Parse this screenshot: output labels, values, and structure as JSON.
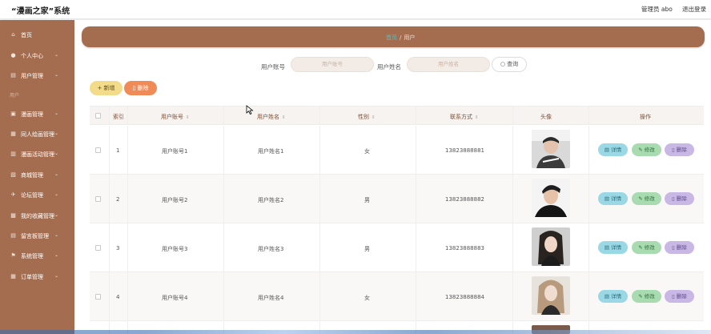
{
  "app": {
    "title": "“漫画之家”系统",
    "user": "管理员 abo",
    "logout": "退出登录"
  },
  "sidebar": {
    "items": [
      {
        "label": "首页",
        "icon": "home-icon",
        "glyph": "⌂",
        "caret": ""
      },
      {
        "label": "个人中心",
        "icon": "user-icon",
        "glyph": "●",
        "caret": "⌄"
      },
      {
        "label": "用户管理",
        "icon": "users-icon",
        "glyph": "▤",
        "caret": "⌄"
      },
      {
        "label": "漫画管理",
        "icon": "book-icon",
        "glyph": "▣",
        "caret": "⌄"
      },
      {
        "label": "同人绘画管理",
        "icon": "paint-icon",
        "glyph": "▦",
        "caret": "⌄"
      },
      {
        "label": "漫画活动管理",
        "icon": "activity-icon",
        "glyph": "▥",
        "caret": "⌄"
      },
      {
        "label": "商城管理",
        "icon": "shop-icon",
        "glyph": "▧",
        "caret": "⌄"
      },
      {
        "label": "论坛管理",
        "icon": "forum-icon",
        "glyph": "✈",
        "caret": "⌄"
      },
      {
        "label": "我的收藏管理",
        "icon": "star-icon",
        "glyph": "▩",
        "caret": "⌄"
      },
      {
        "label": "留言板管理",
        "icon": "message-icon",
        "glyph": "▤",
        "caret": "⌄"
      },
      {
        "label": "系统管理",
        "icon": "flag-icon",
        "glyph": "⚑",
        "caret": "⌄"
      },
      {
        "label": "订单管理",
        "icon": "order-icon",
        "glyph": "▦",
        "caret": "⌄"
      }
    ],
    "extra": "用户"
  },
  "breadcrumb": {
    "home": "首页",
    "sep": "/",
    "current": "用户"
  },
  "filters": {
    "account_label": "用户账号",
    "account_placeholder": "用户账号",
    "name_label": "用户姓名",
    "name_placeholder": "用户姓名",
    "search": "查询"
  },
  "actions": {
    "add": "+ 新增",
    "delete": "删除"
  },
  "table": {
    "headers": {
      "index": "索引",
      "account": "用户账号",
      "name": "用户姓名",
      "gender": "性别",
      "phone": "联系方式",
      "avatar": "头像",
      "ops": "操作"
    },
    "sort_glyph": "⇕",
    "rows": [
      {
        "index": "1",
        "account": "用户账号1",
        "name": "用户姓名1",
        "gender": "女",
        "phone": "13823888881"
      },
      {
        "index": "2",
        "account": "用户账号2",
        "name": "用户姓名2",
        "gender": "男",
        "phone": "13823888882"
      },
      {
        "index": "3",
        "account": "用户账号3",
        "name": "用户姓名3",
        "gender": "男",
        "phone": "13823888883"
      },
      {
        "index": "4",
        "account": "用户账号4",
        "name": "用户姓名4",
        "gender": "女",
        "phone": "13823888884"
      }
    ],
    "row_actions": {
      "view": "详情",
      "edit": "修改",
      "delete": "删除"
    }
  },
  "colors": {
    "brand": "#a56d4f",
    "view": "#9ad8e6",
    "edit": "#a8dcb0",
    "delete": "#c9b7e6",
    "add": "#f2dc8a",
    "batch_delete": "#f08a56"
  }
}
